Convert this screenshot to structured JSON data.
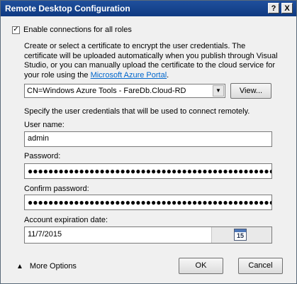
{
  "window": {
    "title": "Remote Desktop Configuration",
    "help_label": "?",
    "close_label": "X"
  },
  "enable": {
    "label": "Enable connections for all roles",
    "checked": true,
    "check_glyph": "✓"
  },
  "description": {
    "text": "Create or select a certificate to encrypt the user credentials. The certificate will be uploaded automatically when you publish through Visual Studio, or you can manually upload the certificate to the cloud service for your role using the ",
    "link_text": "Microsoft Azure Portal",
    "suffix": "."
  },
  "certificate": {
    "selected": "CN=Windows Azure Tools - FareDb.Cloud-RD",
    "dropdown_glyph": "▼",
    "view_label": "View..."
  },
  "credentials_intro": "Specify the user credentials that will be used to connect remotely.",
  "username": {
    "label": "User name:",
    "value": "admin"
  },
  "password": {
    "label": "Password:",
    "value": "●●●●●●●●●●●●●●●●●●●●●●●●●●●●●●●●●●●●●●●●●●●●●●●●●●"
  },
  "confirm_password": {
    "label": "Confirm password:",
    "value": "●●●●●●●●●●●●●●●●●●●●●●●●●●●●●●●●●●●●●●●●●●●●●●●●●●"
  },
  "expiration": {
    "label": "Account expiration date:",
    "value": "11/7/2015",
    "calendar_day": "15"
  },
  "footer": {
    "more_options": "More Options",
    "chevron_glyph": "▲",
    "ok_label": "OK",
    "cancel_label": "Cancel"
  }
}
